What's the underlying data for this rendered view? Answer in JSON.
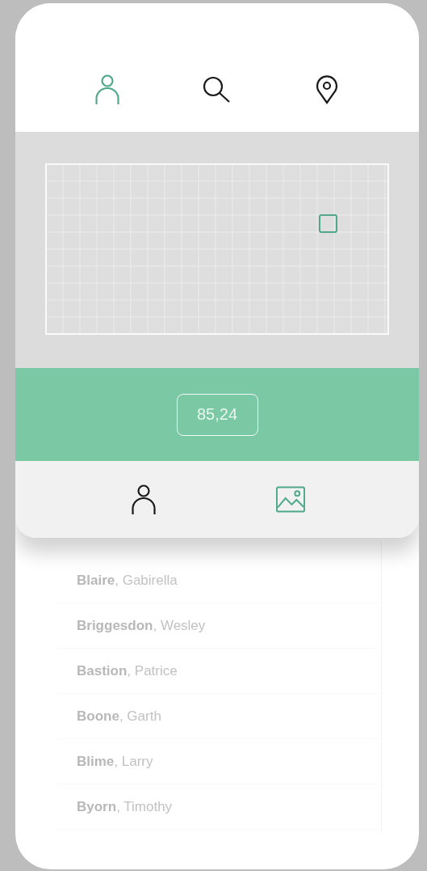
{
  "top_tabs": [
    {
      "kind": "person",
      "selected": true
    },
    {
      "kind": "search",
      "selected": false
    },
    {
      "kind": "pin",
      "selected": false
    }
  ],
  "reading": "85,24",
  "bottom_tabs": [
    {
      "kind": "person",
      "selected": false
    },
    {
      "kind": "image",
      "selected": true
    }
  ],
  "contacts": [
    "**Blaire**, Gabirella",
    "**Briggesdon**, Wesley",
    "**Bastion**, Patrice",
    "**Boone**, Garth",
    "**Blime**, Larry",
    "**Byorn**, Timothy"
  ]
}
